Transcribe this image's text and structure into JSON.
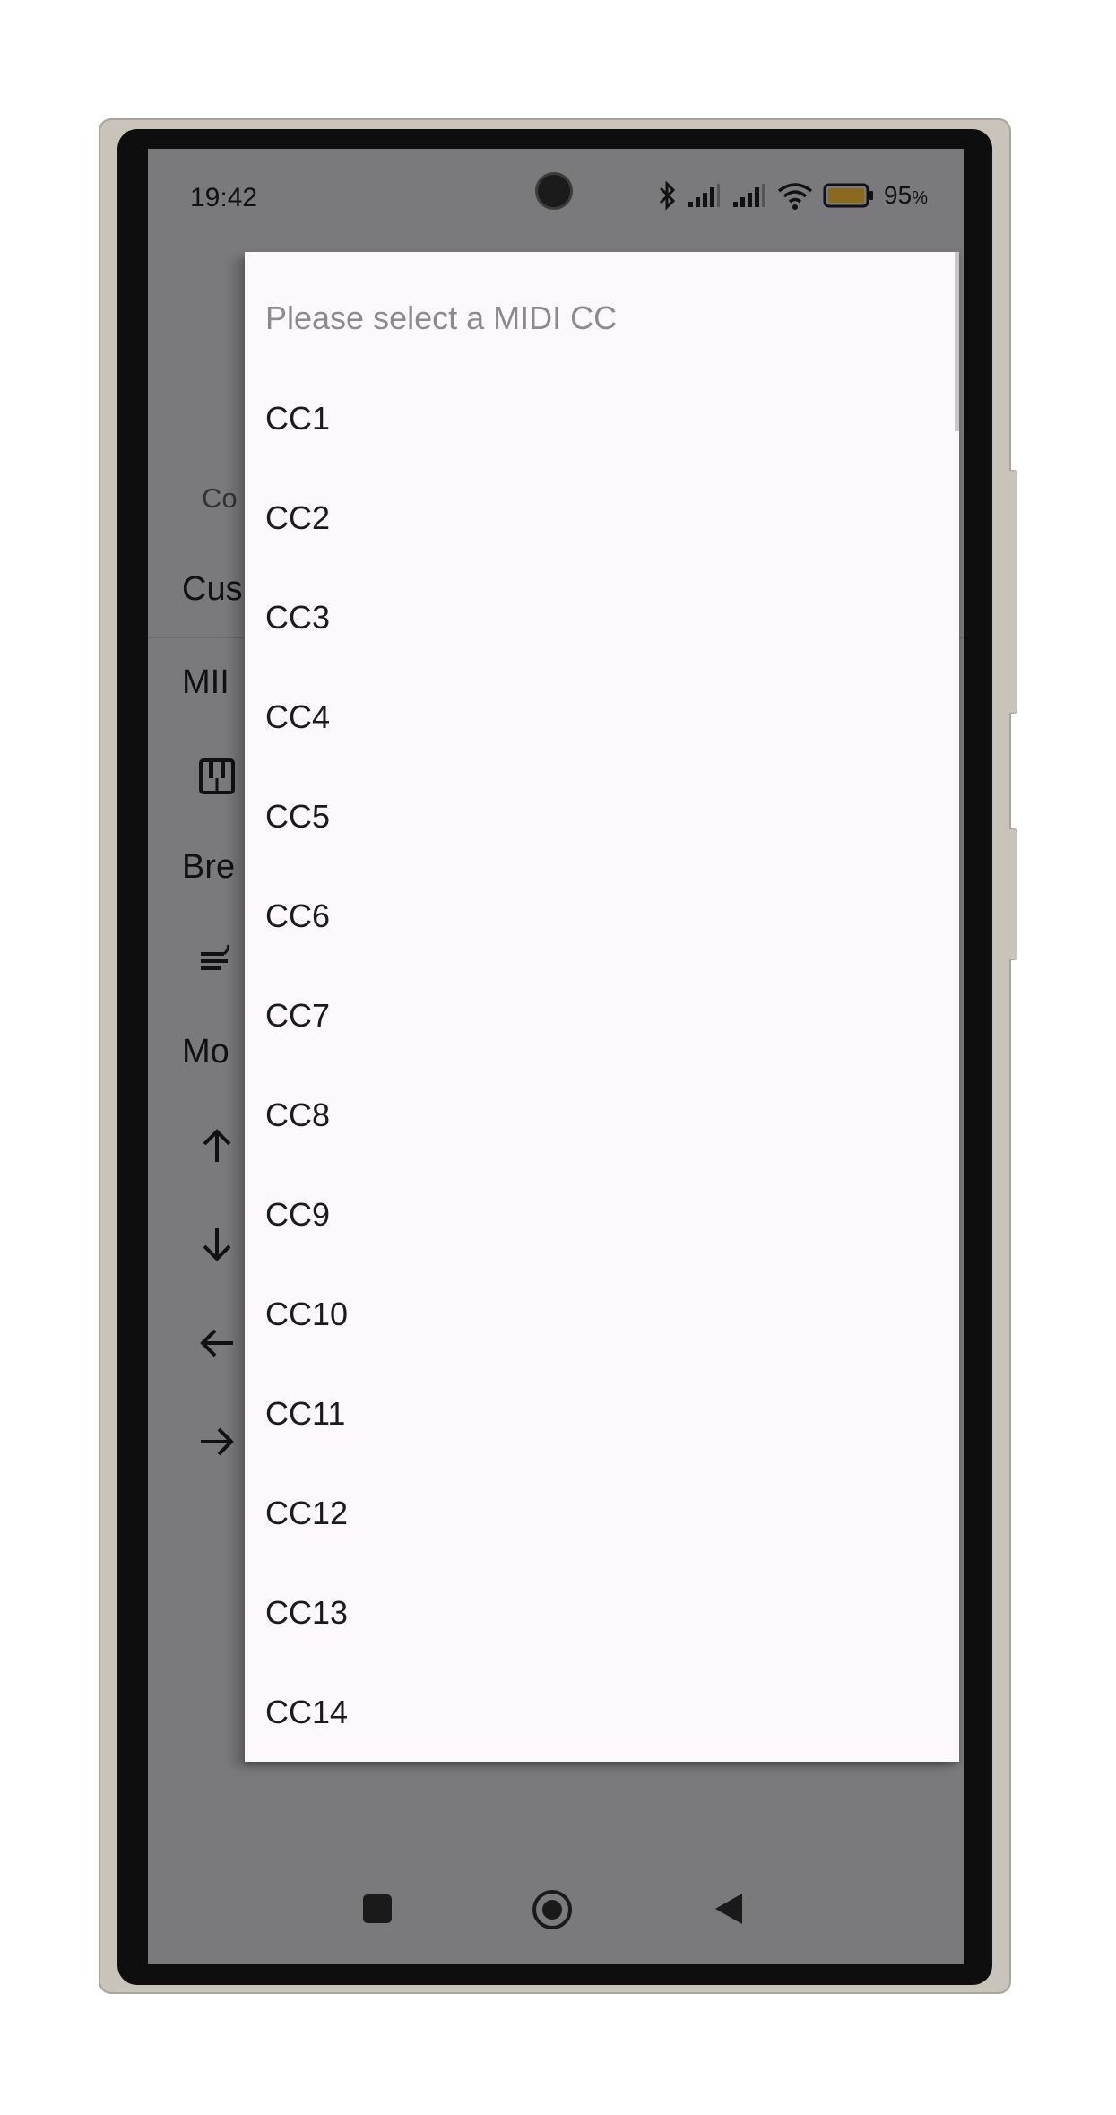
{
  "status_bar": {
    "time": "19:42",
    "battery_percent": "95",
    "battery_unit": "%",
    "icons": [
      "bluetooth-icon",
      "signal-icon",
      "signal-icon",
      "wifi-icon",
      "battery-icon"
    ]
  },
  "background_screen": {
    "tab_label": "Co",
    "headings": [
      "Cus",
      "MII",
      "Bre",
      "Mo"
    ],
    "icons": [
      "piano-icon",
      "wind-icon",
      "arrow-up-icon",
      "arrow-down-icon",
      "arrow-left-icon",
      "arrow-right-icon"
    ]
  },
  "dropdown": {
    "placeholder": "Please select a MIDI CC",
    "items": [
      "CC1",
      "CC2",
      "CC3",
      "CC4",
      "CC5",
      "CC6",
      "CC7",
      "CC8",
      "CC9",
      "CC10",
      "CC11",
      "CC12",
      "CC13",
      "CC14"
    ]
  },
  "nav_bar": {
    "buttons": [
      "recents-button",
      "home-button",
      "back-button"
    ]
  },
  "colors": {
    "scrim": "#7a797b",
    "menu_surface": "#fdf8fc",
    "battery_fill": "#8a6a1f",
    "device_frame": "#c9c4ba"
  }
}
